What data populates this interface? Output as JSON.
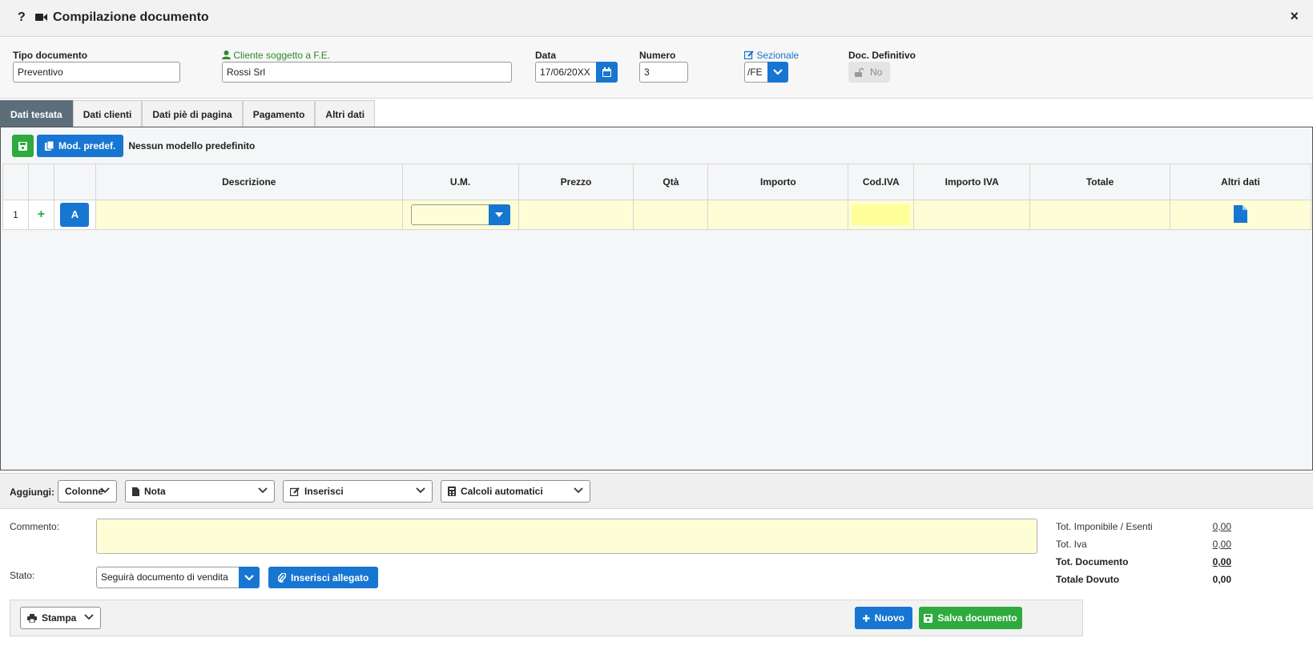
{
  "window": {
    "title": "Compilazione documento",
    "help": "?",
    "close": "×"
  },
  "header": {
    "tipo_label": "Tipo documento",
    "tipo_value": "Preventivo",
    "cliente_label": "Cliente soggetto a F.E.",
    "cliente_value": "Rossi Srl",
    "data_label": "Data",
    "data_value": "17/06/20XX",
    "numero_label": "Numero",
    "numero_value": "3",
    "sezionale_label": "Sezionale",
    "sezionale_value": "/FE",
    "definitivo_label": "Doc. Definitivo",
    "definitivo_value": "No"
  },
  "tabs": [
    {
      "label": "Dati testata",
      "active": true
    },
    {
      "label": "Dati clienti"
    },
    {
      "label": "Dati piè di pagina"
    },
    {
      "label": "Pagamento"
    },
    {
      "label": "Altri dati"
    }
  ],
  "toolbar": {
    "mod_label": "Mod. predef.",
    "mod_status": "Nessun modello predefinito"
  },
  "grid": {
    "columns": [
      "Descrizione",
      "U.M.",
      "Prezzo",
      "Qtà",
      "Importo",
      "Cod.IVA",
      "Importo IVA",
      "Totale",
      "Altri dati"
    ],
    "rows": [
      {
        "num": "1",
        "add": "+",
        "type_btn": "A"
      }
    ]
  },
  "addbar": {
    "label": "Aggiungi:",
    "colonne": "Colonne",
    "nota": "Nota",
    "inserisci": "Inserisci",
    "calcoli": "Calcoli automatici"
  },
  "footer": {
    "commento_label": "Commento:",
    "stato_label": "Stato:",
    "stato_value": "Seguirà documento di vendita",
    "allegato_label": "Inserisci allegato",
    "stampa_label": "Stampa",
    "nuovo_label": "Nuovo",
    "salva_label": "Salva documento"
  },
  "totals": {
    "imponibile_label": "Tot. Imponibile / Esenti",
    "imponibile_value": "0,00",
    "iva_label": "Tot. Iva",
    "iva_value": "0,00",
    "documento_label": "Tot. Documento",
    "documento_value": "0,00",
    "dovuto_label": "Totale Dovuto",
    "dovuto_value": "0,00"
  },
  "colors": {
    "accent_blue": "#1776d2",
    "green": "#2eaa3e",
    "tab_active": "#5b6e7a",
    "row_yellow": "#fefed6"
  }
}
